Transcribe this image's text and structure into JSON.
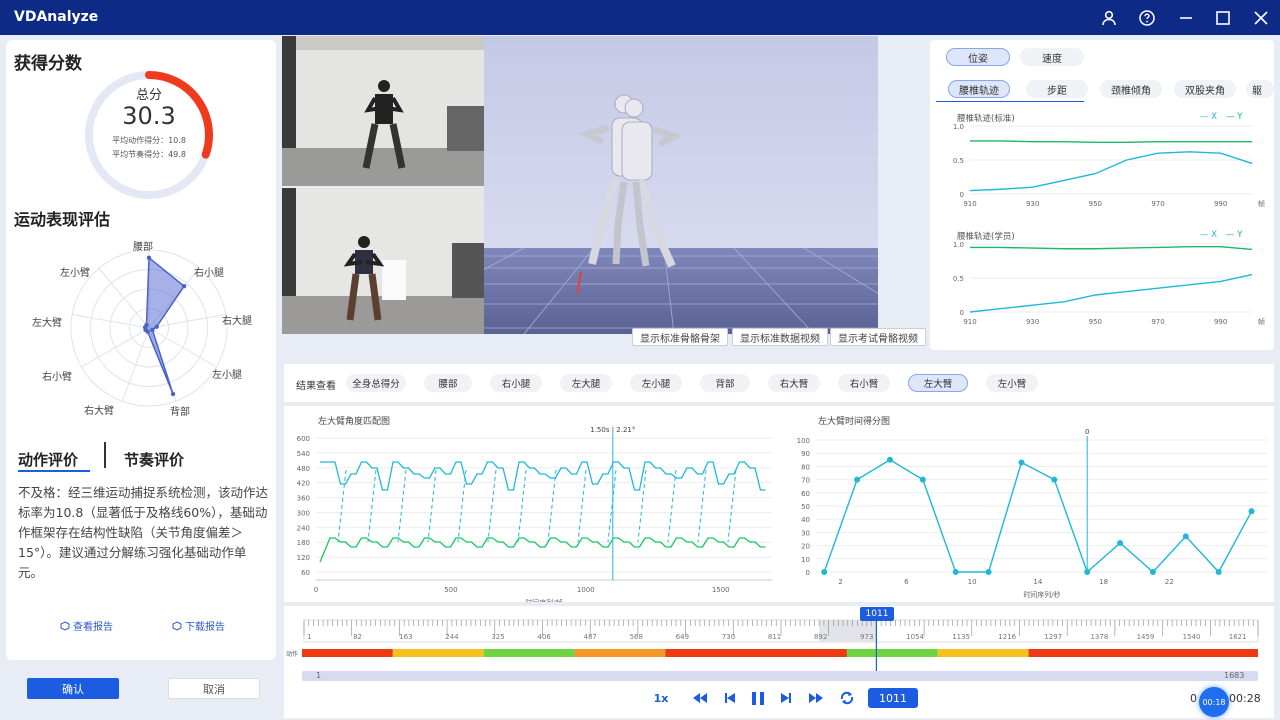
{
  "app": {
    "title": "VDAnalyze"
  },
  "score": {
    "title": "获得分数",
    "total_label": "总分",
    "total_value": "30.3",
    "action_score": "平均动作得分：10.8",
    "rhythm_score": "平均节奏得分：49.8",
    "gauge_fraction": 0.303,
    "accent": "#f03a1e"
  },
  "performance": {
    "title": "运动表现评估",
    "radar_labels": [
      "腰部",
      "右小腿",
      "右大腿",
      "左小腿",
      "背部",
      "右大臂",
      "右小臂",
      "左大臂",
      "左小臂"
    ],
    "radar_values": [
      0.9,
      0.7,
      0.1,
      0.05,
      0.9,
      0.05,
      0.05,
      0.05,
      0.05
    ]
  },
  "evaluation": {
    "tab_action": "动作评价",
    "tab_rhythm": "节奏评价",
    "text": "不及格：经三维运动捕捉系统检测，该动作达标率为10.8（显著低于及格线60%），基础动作框架存在结构性缺陷（关节角度偏差＞15°）。建议通过分解练习强化基础动作单元。",
    "view_report": "查看报告",
    "download_report": "下载报告"
  },
  "buttons": {
    "confirm": "确认",
    "cancel": "取消"
  },
  "viewer": {
    "show_skeleton": "显示标准骨骼骨架",
    "show_std_video": "显示标准数据视频",
    "show_exam_video": "显示考试骨骼视频"
  },
  "right": {
    "tabs_top": [
      "位姿",
      "速度"
    ],
    "tabs_sub": [
      "腰椎轨迹",
      "步距",
      "颈椎倾角",
      "双股夹角",
      "躯"
    ],
    "chart1_title": "腰椎轨迹(标准)",
    "chart2_title": "腰椎轨迹(学员)",
    "legend_x": "X",
    "legend_y": "Y",
    "y_ticks": [
      "1.0",
      "0.5",
      "0"
    ],
    "x_ticks": [
      "910",
      "930",
      "950",
      "970",
      "990"
    ],
    "x_unit": "帧",
    "chart_data": [
      {
        "type": "line",
        "title": "腰椎轨迹(标准)",
        "x": [
          910,
          920,
          930,
          940,
          950,
          960,
          970,
          980,
          990,
          1000
        ],
        "series": [
          {
            "name": "X",
            "values": [
              0.05,
              0.07,
              0.1,
              0.2,
              0.3,
              0.5,
              0.6,
              0.62,
              0.6,
              0.45
            ]
          },
          {
            "name": "Y",
            "values": [
              0.78,
              0.78,
              0.77,
              0.77,
              0.76,
              0.76,
              0.77,
              0.77,
              0.77,
              0.77
            ]
          }
        ],
        "ylim": [
          0,
          1
        ]
      },
      {
        "type": "line",
        "title": "腰椎轨迹(学员)",
        "x": [
          910,
          920,
          930,
          940,
          950,
          960,
          970,
          980,
          990,
          1000
        ],
        "series": [
          {
            "name": "X",
            "values": [
              0.0,
              0.05,
              0.1,
              0.15,
              0.25,
              0.3,
              0.35,
              0.4,
              0.45,
              0.55
            ]
          },
          {
            "name": "Y",
            "values": [
              0.95,
              0.95,
              0.94,
              0.93,
              0.93,
              0.94,
              0.95,
              0.96,
              0.96,
              0.92
            ]
          }
        ],
        "ylim": [
          0,
          1
        ]
      }
    ]
  },
  "chips": {
    "label": "结果查看",
    "items": [
      "全身总得分",
      "腰部",
      "右小腿",
      "左大腿",
      "左小腿",
      "背部",
      "右大臂",
      "右小臂",
      "左大臂",
      "左小臂"
    ],
    "active": "左大臂"
  },
  "angle_chart": {
    "title": "左大臂角度匹配图",
    "cursor_label": "1.50s | 2.21°",
    "y_ticks": [
      "600",
      "540",
      "480",
      "420",
      "360",
      "300",
      "240",
      "180",
      "120",
      "60"
    ],
    "x_ticks": [
      "0",
      "500",
      "1000",
      "1500"
    ],
    "xlabel": "时间序列/帧"
  },
  "score_chart": {
    "title": "左大臂时间得分图",
    "cursor_label": "0",
    "y_ticks": [
      "100",
      "90",
      "80",
      "70",
      "60",
      "50",
      "40",
      "30",
      "20",
      "10",
      "0"
    ],
    "x_ticks": [
      "2",
      "6",
      "10",
      "14",
      "18",
      "22"
    ],
    "xlabel": "时间序列/秒",
    "chart_data": {
      "type": "line",
      "x": [
        1,
        3,
        5,
        7,
        9,
        11,
        13,
        15,
        17,
        19,
        21,
        23,
        25,
        27
      ],
      "values": [
        0,
        70,
        85,
        70,
        0,
        0,
        83,
        70,
        0,
        22,
        0,
        27,
        0,
        46
      ],
      "ylim": [
        0,
        100
      ]
    }
  },
  "timeline": {
    "marker": "1011",
    "ticks": [
      "1",
      "82",
      "163",
      "244",
      "325",
      "406",
      "487",
      "568",
      "649",
      "730",
      "811",
      "892",
      "973",
      "1054",
      "1135",
      "1216",
      "1297",
      "1378",
      "1459",
      "1540",
      "1621"
    ],
    "track_label": "动作",
    "range_start": "1",
    "range_end": "1683",
    "segments": [
      {
        "color": "#ee3a12",
        "frac": 0.095
      },
      {
        "color": "#f4c21b",
        "frac": 0.095
      },
      {
        "color": "#6fd342",
        "frac": 0.095
      },
      {
        "color": "#f29a25",
        "frac": 0.095
      },
      {
        "color": "#ee3a12",
        "frac": 0.19
      },
      {
        "color": "#6fd342",
        "frac": 0.095
      },
      {
        "color": "#f4c21b",
        "frac": 0.095
      },
      {
        "color": "#ee3a12",
        "frac": 0.24
      }
    ],
    "cursor_fraction": 0.6
  },
  "controls": {
    "speed": "1x",
    "frame": "1011",
    "time_left": "0",
    "time_current": "00:18",
    "time_total": "00:28"
  }
}
